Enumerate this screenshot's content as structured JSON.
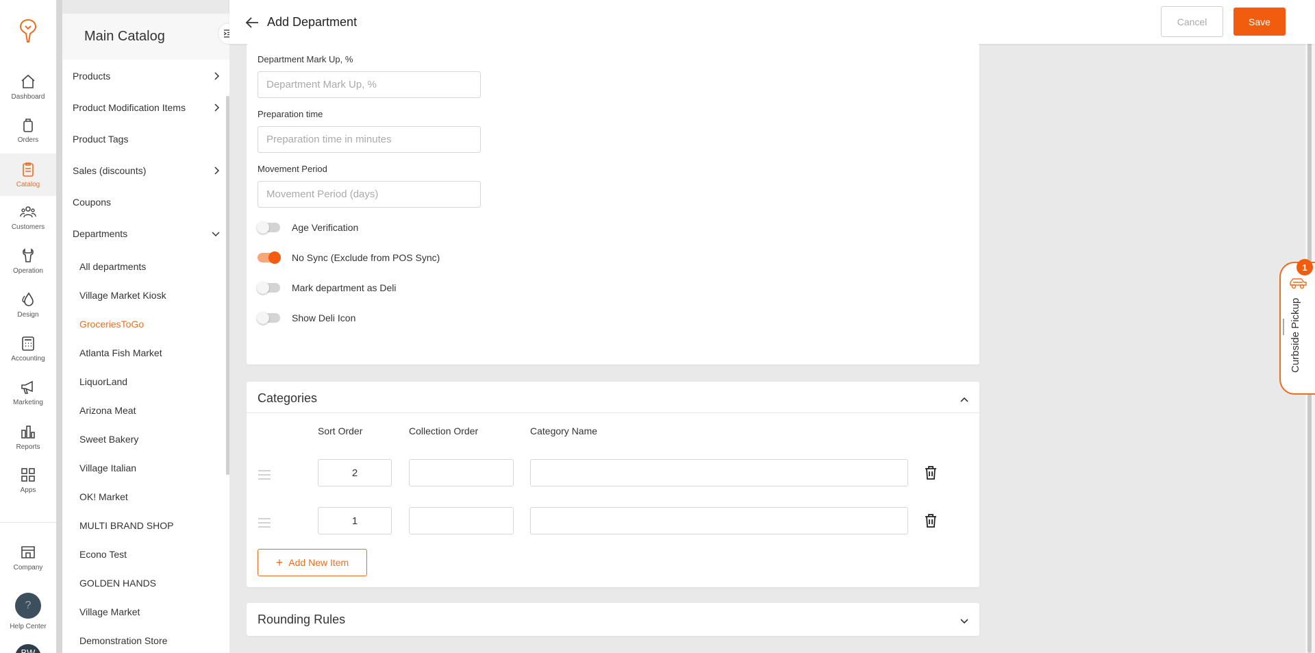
{
  "rail": {
    "items": [
      {
        "label": "Dashboard",
        "icon": "home-icon"
      },
      {
        "label": "Orders",
        "icon": "bag-icon"
      },
      {
        "label": "Catalog",
        "icon": "clipboard-icon"
      },
      {
        "label": "Customers",
        "icon": "users-icon"
      },
      {
        "label": "Operation",
        "icon": "wrench-icon"
      },
      {
        "label": "Design",
        "icon": "drops-icon"
      },
      {
        "label": "Accounting",
        "icon": "calculator-icon"
      },
      {
        "label": "Marketing",
        "icon": "megaphone-icon"
      },
      {
        "label": "Reports",
        "icon": "bar-chart-icon"
      },
      {
        "label": "Apps",
        "icon": "grid-icon"
      },
      {
        "label": "Company",
        "icon": "store-icon"
      },
      {
        "label": "Help Center",
        "icon": "help-icon"
      }
    ],
    "help_glyph": "?",
    "avatar_initials": "BW",
    "accent_color": "#f26b1d"
  },
  "subnav": {
    "title": "Main Catalog",
    "items": [
      {
        "label": "Products",
        "has_children": true
      },
      {
        "label": "Product Modification Items",
        "has_children": true
      },
      {
        "label": "Product Tags",
        "has_children": false
      },
      {
        "label": "Sales (discounts)",
        "has_children": true
      },
      {
        "label": "Coupons",
        "has_children": false
      },
      {
        "label": "Departments",
        "expanded": true
      }
    ],
    "departments": [
      "All departments",
      "Village Market Kiosk",
      "GroceriesToGo",
      "Atlanta Fish Market",
      "LiquorLand",
      "Arizona Meat",
      "Sweet Bakery",
      "Village Italian",
      "OK! Market",
      "MULTI BRAND SHOP",
      "Econo Test",
      "GOLDEN HANDS",
      "Village Market",
      "Demonstration Store"
    ],
    "active_department": "GroceriesToGo"
  },
  "header": {
    "title": "Add Department",
    "cancel_label": "Cancel",
    "save_label": "Save"
  },
  "form": {
    "markup": {
      "label": "Department Mark Up, %",
      "placeholder": "Department Mark Up, %",
      "value": ""
    },
    "prep_time": {
      "label": "Preparation time",
      "placeholder": "Preparation time in minutes",
      "value": ""
    },
    "movement": {
      "label": "Movement Period",
      "placeholder": "Movement Period (days)",
      "value": ""
    },
    "toggles": [
      {
        "label": "Age Verification",
        "on": false
      },
      {
        "label": "No Sync (Exclude from POS Sync)",
        "on": true
      },
      {
        "label": "Mark department as Deli",
        "on": false
      },
      {
        "label": "Show Deli Icon",
        "on": false
      }
    ]
  },
  "categories": {
    "title": "Categories",
    "expanded": true,
    "columns": [
      "Sort Order",
      "Collection Order",
      "Category Name"
    ],
    "rows": [
      {
        "sort_order": "2",
        "collection_order": "",
        "category_name": ""
      },
      {
        "sort_order": "1",
        "collection_order": "",
        "category_name": ""
      }
    ],
    "add_label": "Add New Item"
  },
  "rounding": {
    "title": "Rounding Rules",
    "expanded": false
  },
  "curbside": {
    "label": "Curbside Pickup",
    "badge_count": "1"
  }
}
